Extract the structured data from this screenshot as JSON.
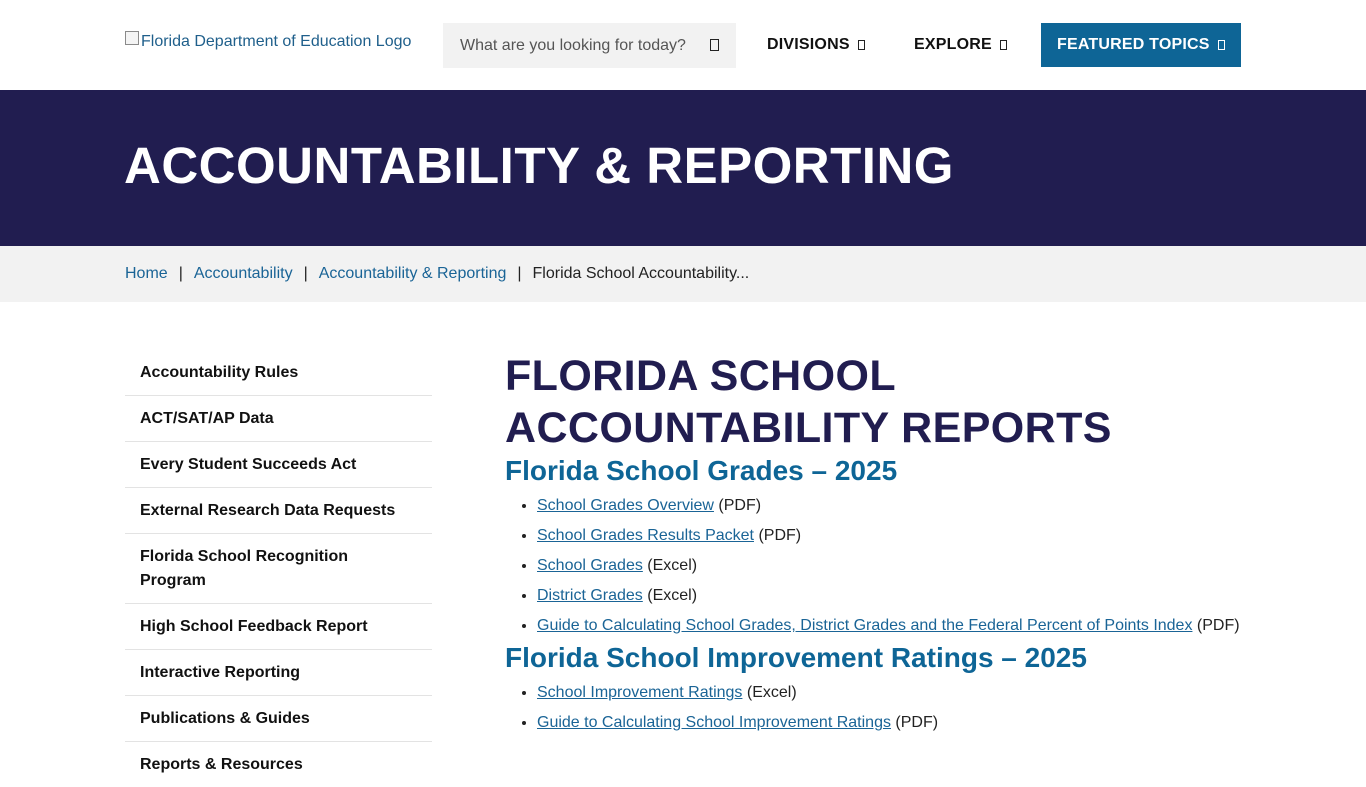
{
  "header": {
    "logo_alt": "Florida Department of Education Logo",
    "search": {
      "placeholder": "What are you looking for today?",
      "icon": "search-icon"
    },
    "nav": {
      "divisions": "DIVISIONS",
      "explore": "EXPLORE",
      "featured": "FEATURED TOPICS",
      "featured_bg": "#0e6596"
    }
  },
  "banner": {
    "title": "ACCOUNTABILITY & REPORTING",
    "bg": "#211d50"
  },
  "breadcrumb": {
    "home": "Home",
    "accountability": "Accountability",
    "reporting": "Accountability & Reporting",
    "current": "Florida School Accountability...",
    "separator": "|"
  },
  "sidebar": {
    "items": [
      {
        "label": "Accountability Rules"
      },
      {
        "label": "ACT/SAT/AP Data"
      },
      {
        "label": "Every Student Succeeds Act"
      },
      {
        "label": "External Research Data Requests"
      },
      {
        "label": "Florida School Recognition Program"
      },
      {
        "label": "High School Feedback Report"
      },
      {
        "label": "Interactive Reporting"
      },
      {
        "label": "Publications & Guides"
      },
      {
        "label": "Reports & Resources"
      }
    ]
  },
  "main": {
    "title": "FLORIDA SCHOOL ACCOUNTABILITY REPORTS",
    "sections": [
      {
        "heading": "Florida School Grades – 2025",
        "links": [
          {
            "text": "School Grades Overview",
            "suffix": " (PDF)"
          },
          {
            "text": "School Grades Results Packet",
            "suffix": " (PDF)"
          },
          {
            "text": "School Grades",
            "suffix": " (Excel)"
          },
          {
            "text": "District Grades",
            "suffix": " (Excel)"
          },
          {
            "text": "Guide to Calculating School Grades, District Grades and the Federal Percent of Points Index",
            "suffix": " (PDF)"
          }
        ]
      },
      {
        "heading": "Florida School Improvement Ratings – 2025",
        "links": [
          {
            "text": "School Improvement Ratings",
            "suffix": " (Excel)"
          },
          {
            "text": "Guide to Calculating School Improvement Ratings",
            "suffix": " (PDF)"
          }
        ]
      }
    ]
  }
}
